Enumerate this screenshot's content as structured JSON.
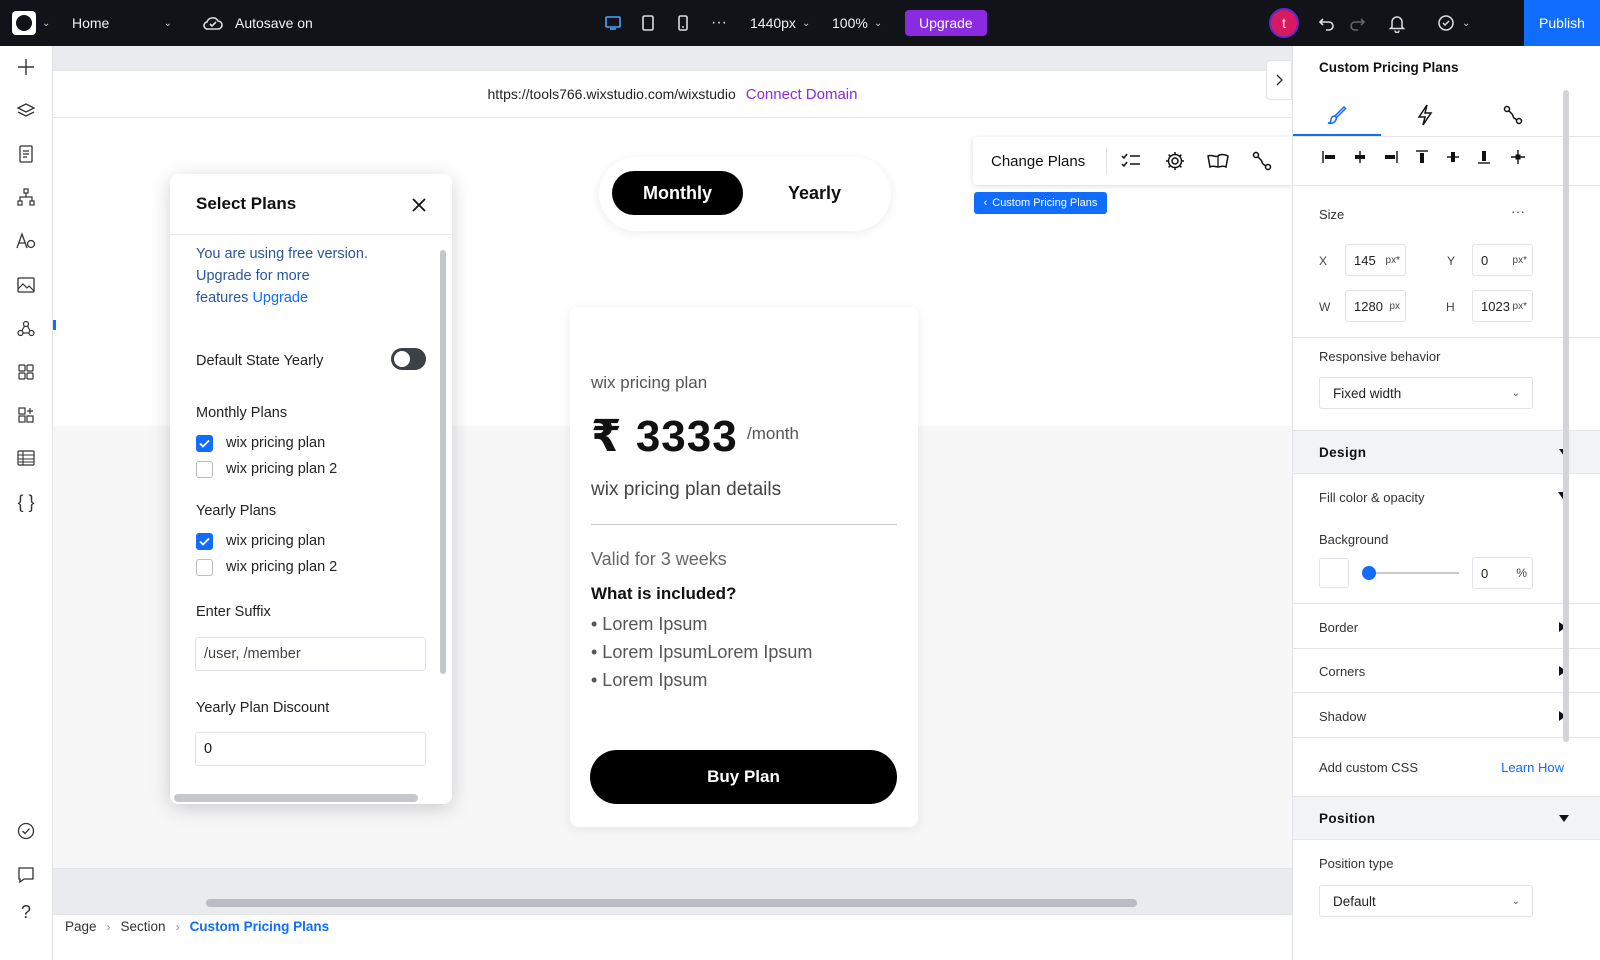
{
  "topbar": {
    "page_select": "Home",
    "autosave": "Autosave on",
    "width_select": "1440px",
    "zoom": "100%",
    "upgrade_label": "Upgrade",
    "avatar_letter": "t",
    "publish_label": "Publish"
  },
  "canvas": {
    "site_url": "https://tools766.wixstudio.com/wixstudio",
    "connect_domain": "Connect Domain",
    "toggle": {
      "monthly": "Monthly",
      "yearly": "Yearly"
    },
    "context_toolbar": {
      "change_plans": "Change Plans"
    },
    "component_tag": "Custom Pricing Plans",
    "pricing_card": {
      "plan_name": "wix pricing plan",
      "price": "₹ 3333",
      "period": "/month",
      "details": "wix pricing plan details",
      "validity": "Valid for 3 weeks",
      "included_heading": "What is included?",
      "features": [
        "• Lorem Ipsum",
        "• Lorem IpsumLorem Ipsum",
        "• Lorem Ipsum"
      ],
      "buy_label": "Buy Plan"
    }
  },
  "select_plans": {
    "title": "Select Plans",
    "free_notice_line1": "You are using free version.",
    "free_notice_line2": "Upgrade for more",
    "free_notice_line3": "features",
    "free_notice_link": "Upgrade",
    "default_state_label": "Default State Yearly",
    "default_state_on": false,
    "monthly_heading": "Monthly Plans",
    "monthly_plans": [
      {
        "label": "wix pricing plan",
        "checked": true
      },
      {
        "label": "wix pricing plan 2",
        "checked": false
      }
    ],
    "yearly_heading": "Yearly Plans",
    "yearly_plans": [
      {
        "label": "wix pricing plan",
        "checked": true
      },
      {
        "label": "wix pricing plan 2",
        "checked": false
      }
    ],
    "suffix_label": "Enter Suffix",
    "suffix_placeholder": "/user, /member",
    "discount_label": "Yearly Plan Discount",
    "discount_value": "0"
  },
  "breadcrumb": {
    "items": [
      "Page",
      "Section",
      "Custom Pricing Plans"
    ]
  },
  "inspector": {
    "title": "Custom Pricing Plans",
    "size_label": "Size",
    "more": "···",
    "x_label": "X",
    "x_value": "145",
    "x_unit": "px*",
    "y_label": "Y",
    "y_value": "0",
    "y_unit": "px*",
    "w_label": "W",
    "w_value": "1280",
    "w_unit": "px",
    "h_label": "H",
    "h_value": "1023",
    "h_unit": "px*",
    "responsive_label": "Responsive behavior",
    "responsive_value": "Fixed width",
    "design_heading": "Design",
    "fill_label": "Fill color & opacity",
    "background_label": "Background",
    "opacity_value": "0",
    "opacity_unit": "%",
    "border_label": "Border",
    "corners_label": "Corners",
    "shadow_label": "Shadow",
    "custom_css_label": "Add custom CSS",
    "learn_how": "Learn How",
    "position_heading": "Position",
    "position_type_label": "Position type",
    "position_type_value": "Default"
  },
  "colors": {
    "accent": "#116dff",
    "upgrade": "#8a2be2",
    "topbar": "#111319",
    "avatar": "#d81b60"
  }
}
